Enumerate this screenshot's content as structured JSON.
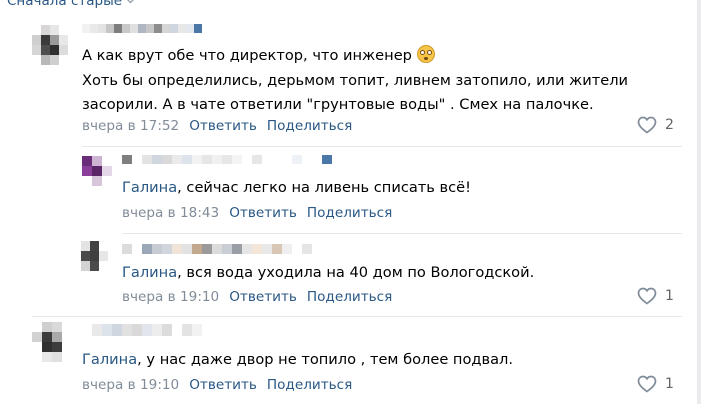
{
  "header": {
    "sort_label": "Сначала старые",
    "sort_icon": "chevron-down-icon"
  },
  "comments": [
    {
      "text_line1": "А как врут обе что директор, что инженер",
      "emoji": "astonished-face",
      "text_line2": "Хоть бы определились, дерьмом топит, ливнем затопило, или жители",
      "text_line3": "засорили. А в чате ответили \"грунтовые воды\" . Смех на палочке.",
      "time": "вчера в 17:52",
      "reply": "Ответить",
      "share": "Поделиться",
      "likes": "2"
    },
    {
      "mention": "Галина",
      "text": ", сейчас легко на ливень списать всё!",
      "time": "вчера в 18:43",
      "reply": "Ответить",
      "share": "Поделиться"
    },
    {
      "mention": "Галина",
      "text": ", вся вода уходила на 40 дом по Вологодской.",
      "time": "вчера в 19:10",
      "reply": "Ответить",
      "share": "Поделиться",
      "likes": "1"
    },
    {
      "mention": "Галина",
      "text": ", у нас даже двор не топило , тем более подвал.",
      "time": "вчера в 19:10",
      "reply": "Ответить",
      "share": "Поделиться",
      "likes": "1"
    }
  ],
  "colors": {
    "link": "#2a5885",
    "meta": "#818c99",
    "divider": "#e7e8ec"
  }
}
